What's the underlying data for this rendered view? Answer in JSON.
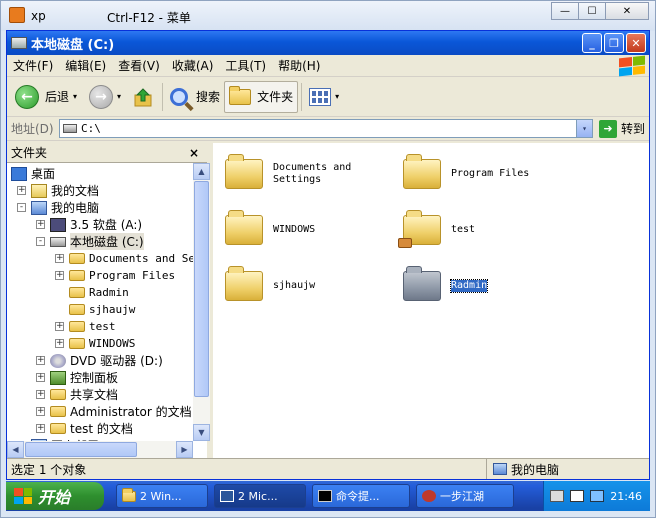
{
  "host": {
    "app_name": "xp",
    "caption": "Ctrl-F12 - 菜单",
    "buttons": [
      "—",
      "☐",
      "✕"
    ]
  },
  "window": {
    "title": "本地磁盘 (C:)",
    "buttons": [
      "_",
      "❐",
      "✕"
    ]
  },
  "menu": [
    "文件(F)",
    "编辑(E)",
    "查看(V)",
    "收藏(A)",
    "工具(T)",
    "帮助(H)"
  ],
  "toolbar": {
    "back_label": "后退",
    "search_label": "搜索",
    "folders_label": "文件夹",
    "dropdown_glyph": "▾"
  },
  "address": {
    "label": "地址(D)",
    "value": "C:\\",
    "go_label": "转到"
  },
  "folders_pane": {
    "title": "文件夹",
    "close": "×",
    "tree": [
      {
        "label": "桌面",
        "level": 0,
        "icon": "desktop-icon",
        "expander": "",
        "cjk": true
      },
      {
        "label": "我的文档",
        "level": 1,
        "icon": "my-documents-icon",
        "expander": "+",
        "cjk": true
      },
      {
        "label": "我的电脑",
        "level": 1,
        "icon": "my-computer-icon",
        "expander": "-",
        "cjk": true
      },
      {
        "label": "3.5 软盘 (A:)",
        "level": 2,
        "icon": "floppy-icon",
        "expander": "+",
        "cjk": true
      },
      {
        "label": "本地磁盘 (C:)",
        "level": 2,
        "icon": "hard-disk-icon",
        "expander": "-",
        "cjk": true,
        "selected": true
      },
      {
        "label": "Documents and Set",
        "level": 3,
        "icon": "folder-icon",
        "expander": "+"
      },
      {
        "label": "Program Files",
        "level": 3,
        "icon": "folder-icon",
        "expander": "+"
      },
      {
        "label": "Radmin",
        "level": 3,
        "icon": "folder-icon",
        "expander": ""
      },
      {
        "label": "sjhaujw",
        "level": 3,
        "icon": "folder-icon",
        "expander": ""
      },
      {
        "label": "test",
        "level": 3,
        "icon": "shared-folder-icon",
        "expander": "+"
      },
      {
        "label": "WINDOWS",
        "level": 3,
        "icon": "folder-icon",
        "expander": "+"
      },
      {
        "label": "DVD 驱动器 (D:)",
        "level": 2,
        "icon": "dvd-icon",
        "expander": "+",
        "cjk": true
      },
      {
        "label": "控制面板",
        "level": 2,
        "icon": "control-panel-icon",
        "expander": "+",
        "cjk": true
      },
      {
        "label": "共享文档",
        "level": 2,
        "icon": "folder-icon",
        "expander": "+",
        "cjk": true
      },
      {
        "label": "Administrator 的文档",
        "level": 2,
        "icon": "folder-icon",
        "expander": "+",
        "cjk": true
      },
      {
        "label": "test 的文档",
        "level": 2,
        "icon": "folder-icon",
        "expander": "+",
        "cjk": true
      },
      {
        "label": "网上邻居",
        "level": 1,
        "icon": "network-icon",
        "expander": "+",
        "cjk": true
      }
    ]
  },
  "files": [
    {
      "name": "Documents and Settings",
      "line1": "Documents and",
      "line2": "Settings",
      "kind": "folder"
    },
    {
      "name": "Program Files",
      "line1": "Program Files",
      "line2": "",
      "kind": "folder"
    },
    {
      "name": "WINDOWS",
      "line1": "WINDOWS",
      "line2": "",
      "kind": "folder"
    },
    {
      "name": "test",
      "line1": "test",
      "line2": "",
      "kind": "shared"
    },
    {
      "name": "sjhaujw",
      "line1": "sjhaujw",
      "line2": "",
      "kind": "folder"
    },
    {
      "name": "Radmin",
      "line1": "Radmin",
      "line2": "",
      "kind": "selected"
    }
  ],
  "status": {
    "left": "选定 1 个对象",
    "right": "我的电脑"
  },
  "taskbar": {
    "start_label": "开始",
    "buttons": [
      "2 Win...",
      "2 Mic...",
      "命令提...",
      "一步江湖"
    ],
    "clock": "21:46"
  },
  "colors": {
    "xp_blue": "#0a57d8",
    "selection": "#316ac5",
    "start_green": "#2e8f2e"
  }
}
